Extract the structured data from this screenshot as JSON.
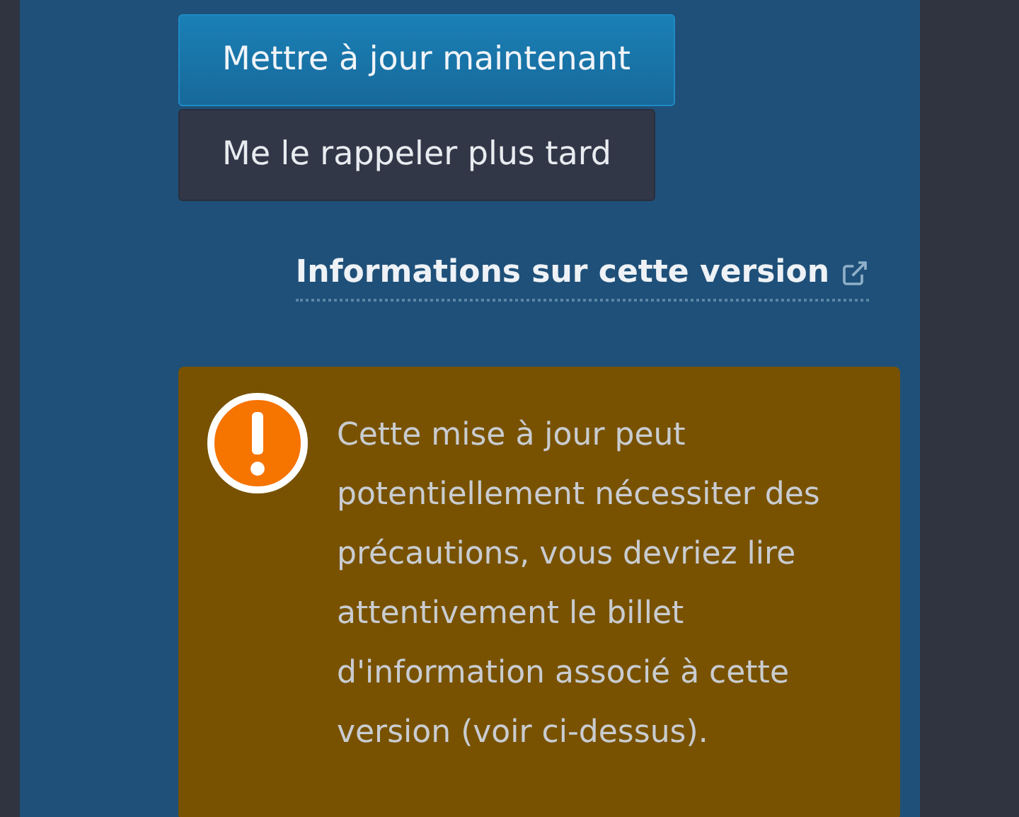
{
  "buttons": [
    {
      "label": "Mettre à jour maintenant",
      "kind": "primary"
    },
    {
      "label": "Me le rappeler plus tard",
      "kind": "secondary"
    }
  ],
  "release_link": {
    "label": "Informations sur cette version"
  },
  "warning": {
    "text": "Cette mise à jour peut potentiellement nécessiter des précautions, vous devriez lire attentivement le billet d'information associé à cette version (voir ci-dessus)."
  }
}
